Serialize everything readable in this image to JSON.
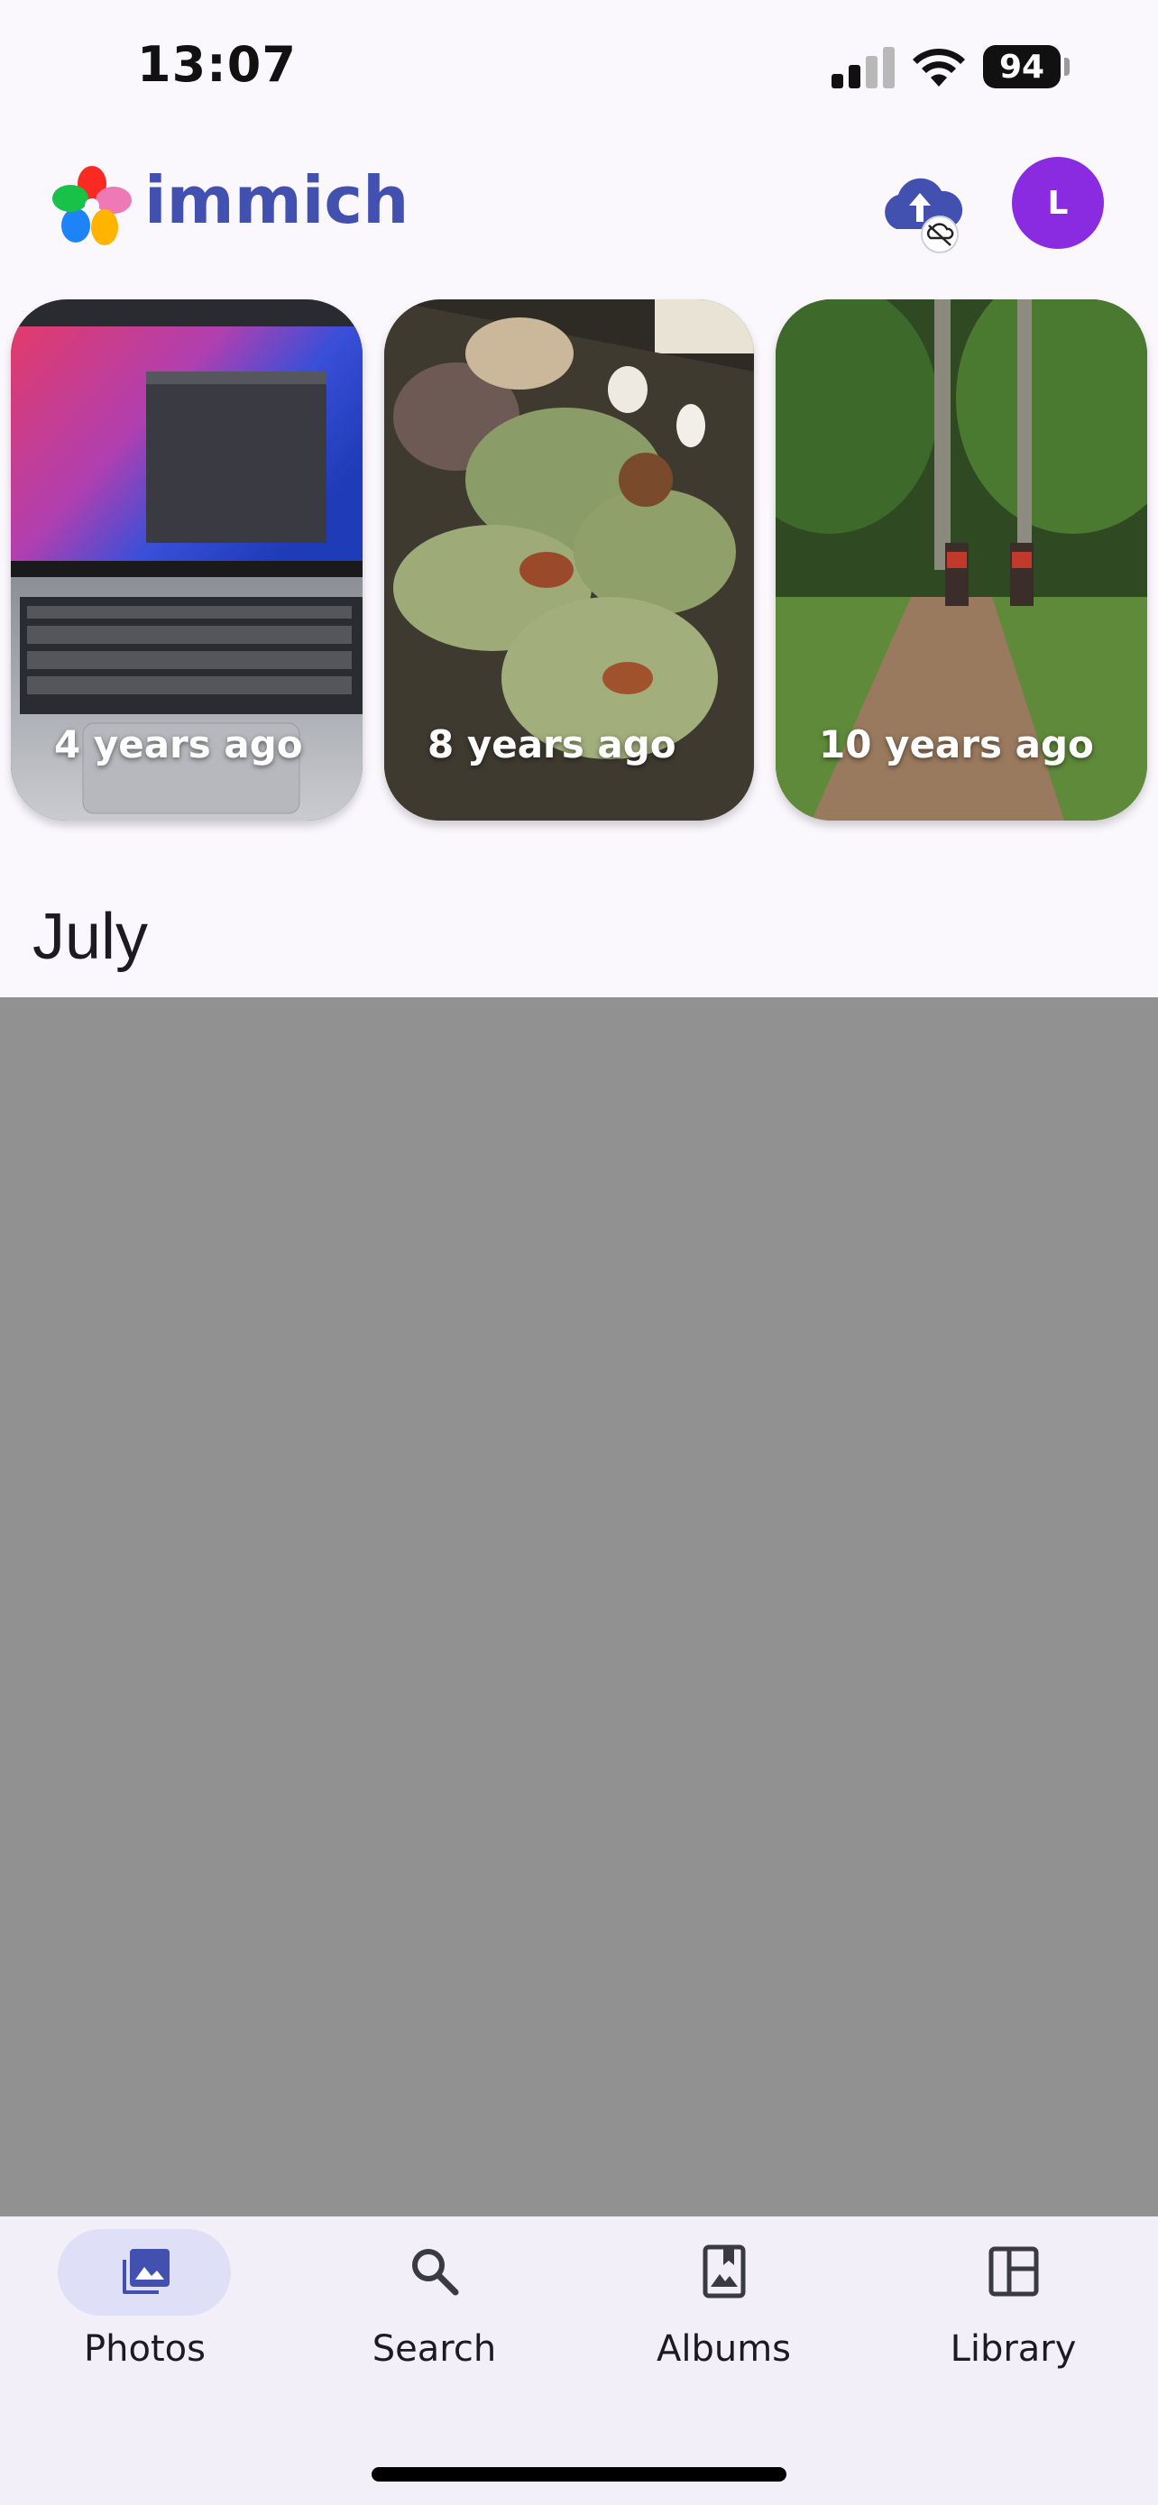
{
  "status_bar": {
    "time": "13:07",
    "battery": "94"
  },
  "app": {
    "name": "immich",
    "avatar_initial": "L",
    "accent": "#4250af",
    "avatar_color": "#8a2be2"
  },
  "header_icons": {
    "upload": "cloud-upload-icon",
    "sync_status": "cloud-off-icon"
  },
  "memories": [
    {
      "label": "4 years ago"
    },
    {
      "label": "8 years ago"
    },
    {
      "label": "10 years ago"
    }
  ],
  "timeline": {
    "month": "July"
  },
  "bottom_nav": {
    "items": [
      {
        "label": "Photos",
        "icon": "photos-icon",
        "active": true
      },
      {
        "label": "Search",
        "icon": "search-icon",
        "active": false
      },
      {
        "label": "Albums",
        "icon": "albums-icon",
        "active": false
      },
      {
        "label": "Library",
        "icon": "library-icon",
        "active": false
      }
    ]
  }
}
